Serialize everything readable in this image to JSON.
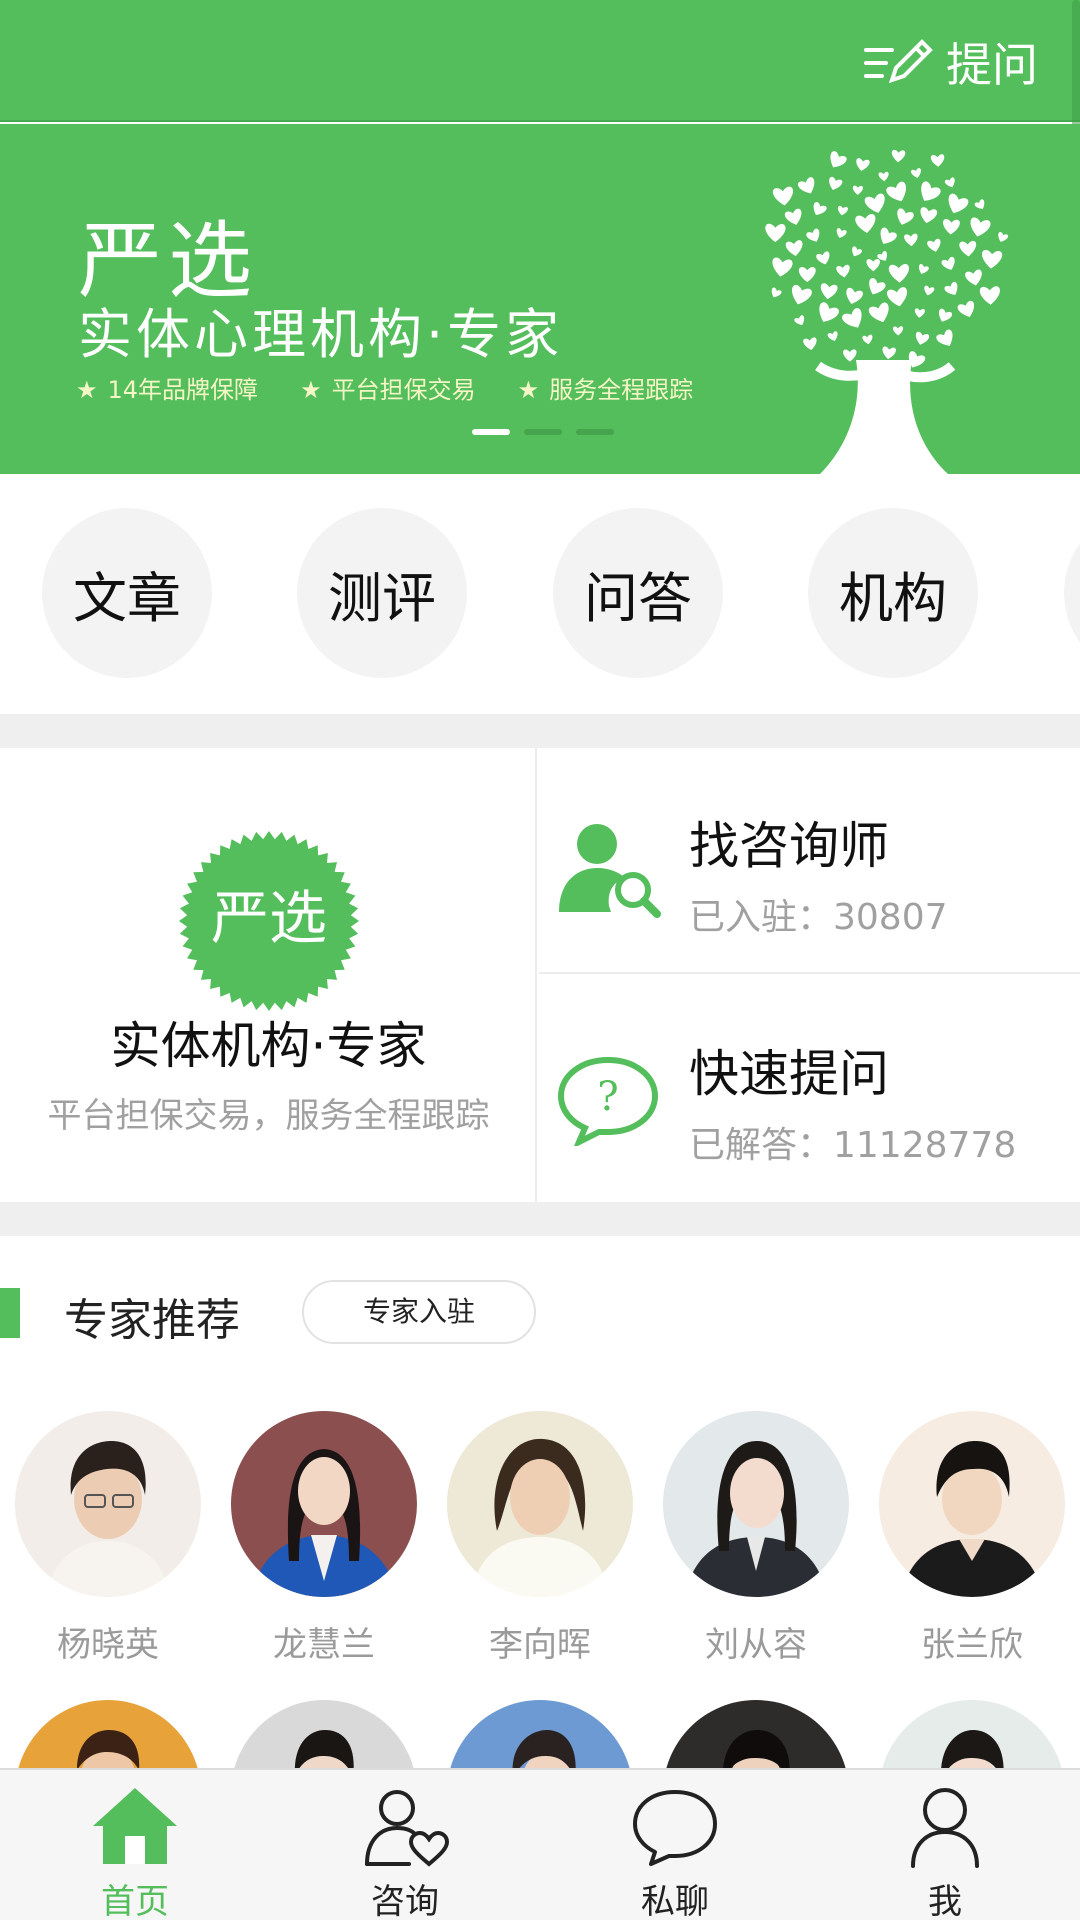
{
  "topbar": {
    "ask_label": "提问",
    "ask_icon": "pencil-lines-icon"
  },
  "banner": {
    "title": "严选",
    "subtitle": "实体心理机构·专家",
    "features": [
      "14年品牌保障",
      "平台担保交易",
      "服务全程跟踪"
    ],
    "slides": 3,
    "active_slide": 1
  },
  "quick_nav": [
    {
      "label": "文章"
    },
    {
      "label": "测评"
    },
    {
      "label": "问答"
    },
    {
      "label": "机构"
    }
  ],
  "feature": {
    "badge_text": "严选",
    "title": "实体机构·专家",
    "desc": "平台担保交易，服务全程跟踪",
    "find": {
      "title": "找咨询师",
      "stat": "已入驻：30807",
      "icon": "user-search-icon"
    },
    "ask": {
      "title": "快速提问",
      "stat": "已解答：11128778",
      "icon": "question-bubble-icon"
    }
  },
  "experts": {
    "title": "专家推荐",
    "join_label": "专家入驻",
    "people": [
      {
        "name": "杨晓英"
      },
      {
        "name": "龙慧兰"
      },
      {
        "name": "李向晖"
      },
      {
        "name": "刘从容"
      },
      {
        "name": "张兰欣"
      }
    ]
  },
  "tabbar": {
    "tabs": [
      {
        "label": "首页",
        "icon": "home-icon",
        "active": true
      },
      {
        "label": "咨询",
        "icon": "person-heart-icon",
        "active": false
      },
      {
        "label": "私聊",
        "icon": "chat-bubble-icon",
        "active": false
      },
      {
        "label": "我",
        "icon": "user-icon",
        "active": false
      }
    ]
  },
  "colors": {
    "brand_green": "#53be5b",
    "accent_yellow": "#f4f6c6",
    "muted_text": "#a0a0a0"
  }
}
